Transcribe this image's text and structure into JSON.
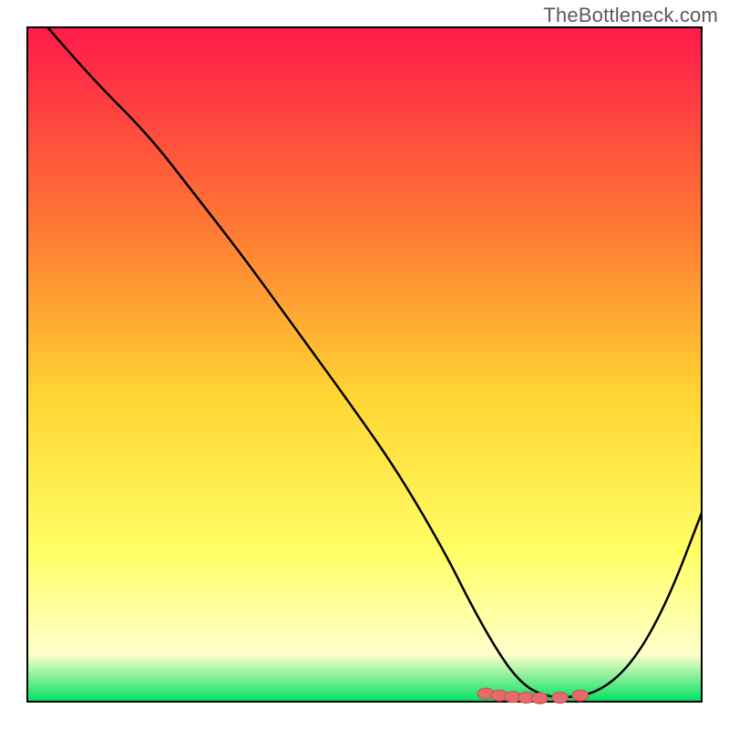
{
  "watermark": "TheBottleneck.com",
  "colors": {
    "gradient_top": "#ff1a4a",
    "gradient_mid_upper": "#ff7a33",
    "gradient_mid": "#ffd633",
    "gradient_lower": "#ffff66",
    "gradient_pale": "#ffffcc",
    "gradient_bottom": "#00e060",
    "curve": "#000000",
    "marker_fill": "#e86a6a",
    "marker_stroke": "#c24f4f",
    "frame": "#000000"
  },
  "chart_data": {
    "type": "line",
    "title": "",
    "xlabel": "",
    "ylabel": "",
    "xlim": [
      0,
      100
    ],
    "ylim": [
      0,
      100
    ],
    "series": [
      {
        "name": "curve",
        "x": [
          3,
          10,
          18,
          25,
          32,
          40,
          48,
          55,
          62,
          66,
          70,
          73,
          76,
          80,
          85,
          90,
          95,
          100
        ],
        "values": [
          100,
          92,
          84,
          75,
          66,
          55,
          44,
          34,
          22,
          14,
          7,
          3,
          1,
          0.5,
          1.5,
          6,
          15,
          28
        ]
      }
    ],
    "markers": {
      "name": "highlight-points",
      "x": [
        68,
        70,
        72,
        74,
        76,
        79,
        82
      ],
      "values": [
        1.2,
        0.9,
        0.7,
        0.6,
        0.5,
        0.6,
        0.9
      ]
    },
    "gradient_stops": [
      {
        "pos": 0.0,
        "color": "#ff1a4a"
      },
      {
        "pos": 0.3,
        "color": "#ff7a33"
      },
      {
        "pos": 0.55,
        "color": "#ffd633"
      },
      {
        "pos": 0.78,
        "color": "#ffff66"
      },
      {
        "pos": 0.93,
        "color": "#ffffcc"
      },
      {
        "pos": 1.0,
        "color": "#00e060"
      }
    ]
  }
}
